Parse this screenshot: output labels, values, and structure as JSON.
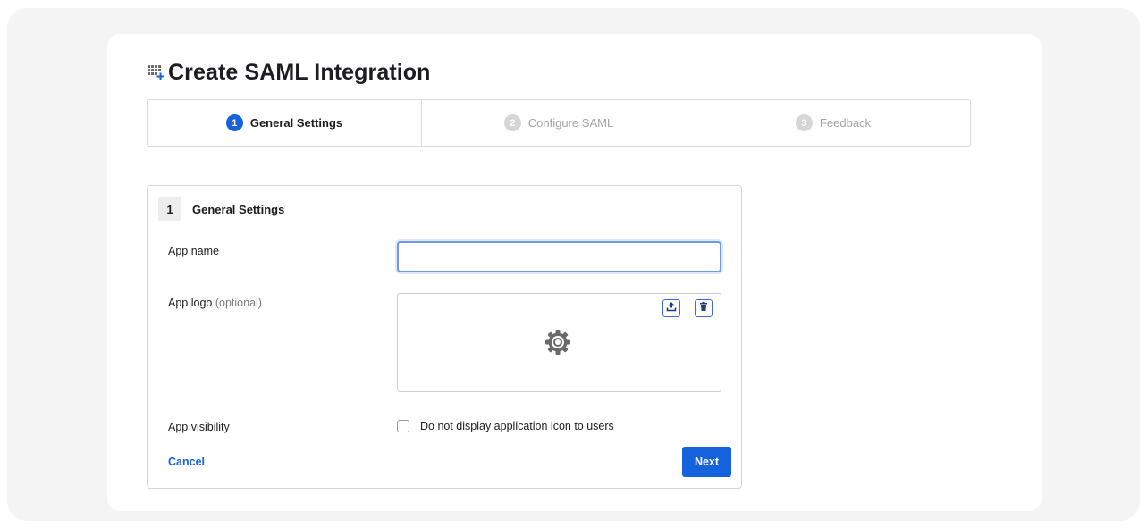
{
  "page": {
    "title": "Create SAML Integration",
    "title_icon": "grid-plus-icon"
  },
  "stepper": {
    "steps": [
      {
        "number": "1",
        "label": "General Settings",
        "state": "active"
      },
      {
        "number": "2",
        "label": "Configure SAML",
        "state": "inactive"
      },
      {
        "number": "3",
        "label": "Feedback",
        "state": "inactive"
      }
    ]
  },
  "section": {
    "number": "1",
    "title": "General Settings"
  },
  "form": {
    "app_name_label": "App name",
    "app_name_value": "",
    "app_logo_label": "App logo",
    "app_logo_optional": "(optional)",
    "app_logo_placeholder_icon": "gear-icon",
    "upload_icon": "upload-icon",
    "delete_icon": "trash-icon",
    "app_visibility_label": "App visibility",
    "visibility_checkbox_label": "Do not display application icon to users",
    "visibility_checked": false
  },
  "actions": {
    "cancel_label": "Cancel",
    "next_label": "Next"
  },
  "colors": {
    "accent": "#1662dd",
    "inactive_step": "#d6d6d6",
    "background": "#f4f4f4"
  }
}
